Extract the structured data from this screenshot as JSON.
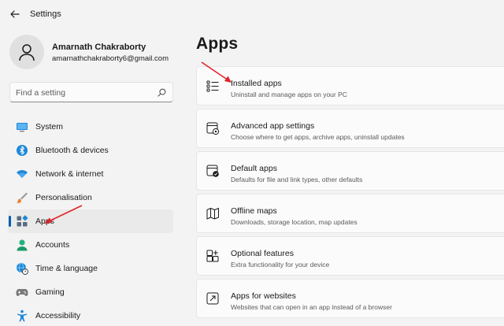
{
  "window": {
    "title": "Settings"
  },
  "profile": {
    "name": "Amarnath Chakraborty",
    "email": "amarnathchakraborty6@gmail.com"
  },
  "search": {
    "placeholder": "Find a setting"
  },
  "sidebar": {
    "items": [
      {
        "label": "System",
        "icon": "monitor-icon"
      },
      {
        "label": "Bluetooth & devices",
        "icon": "bluetooth-icon"
      },
      {
        "label": "Network & internet",
        "icon": "wifi-icon"
      },
      {
        "label": "Personalisation",
        "icon": "brush-icon"
      },
      {
        "label": "Apps",
        "icon": "apps-icon",
        "active": true
      },
      {
        "label": "Accounts",
        "icon": "person-icon"
      },
      {
        "label": "Time & language",
        "icon": "globe-clock-icon"
      },
      {
        "label": "Gaming",
        "icon": "gamepad-icon"
      },
      {
        "label": "Accessibility",
        "icon": "accessibility-icon"
      }
    ]
  },
  "main": {
    "title": "Apps",
    "cards": [
      {
        "title": "Installed apps",
        "subtitle": "Uninstall and manage apps on your PC",
        "icon": "list-icon"
      },
      {
        "title": "Advanced app settings",
        "subtitle": "Choose where to get apps, archive apps, uninstall updates",
        "icon": "app-gear-icon"
      },
      {
        "title": "Default apps",
        "subtitle": "Defaults for file and link types, other defaults",
        "icon": "default-apps-icon"
      },
      {
        "title": "Offline maps",
        "subtitle": "Downloads, storage location, map updates",
        "icon": "map-icon"
      },
      {
        "title": "Optional features",
        "subtitle": "Extra functionality for your device",
        "icon": "add-grid-icon"
      },
      {
        "title": "Apps for websites",
        "subtitle": "Websites that can open in an app instead of a browser",
        "icon": "open-link-icon"
      }
    ]
  },
  "colors": {
    "accent": "#005fb8",
    "annotation_arrow": "#e0242a"
  }
}
